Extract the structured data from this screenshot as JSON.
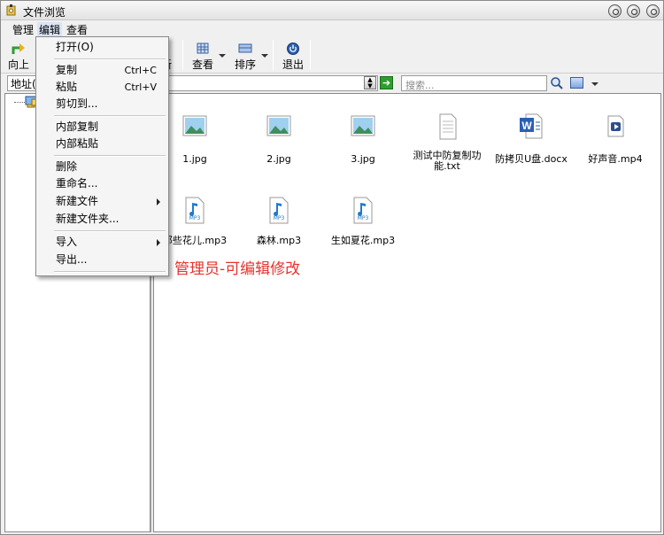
{
  "window": {
    "title": "文件浏览"
  },
  "menubar": {
    "items": [
      "管理",
      "编辑",
      "查看"
    ]
  },
  "toolbar": {
    "up_label": "向上",
    "refresh_label_partial": "新",
    "view_label": "查看",
    "sort_label": "排序",
    "exit_label": "退出"
  },
  "addressbar": {
    "label": "地址(",
    "search_placeholder": "搜索..."
  },
  "edit_menu": {
    "open": "打开(O)",
    "copy": "复制",
    "copy_shortcut": "Ctrl+C",
    "paste": "粘贴",
    "paste_shortcut": "Ctrl+V",
    "cut_to": "剪切到...",
    "internal_copy": "内部复制",
    "internal_paste": "内部粘贴",
    "delete": "删除",
    "rename": "重命名...",
    "new_file": "新建文件",
    "new_folder": "新建文件夹...",
    "import": "导入",
    "export": "导出..."
  },
  "files": [
    {
      "name": "1.jpg",
      "icon": "image-icon"
    },
    {
      "name": "2.jpg",
      "icon": "image-icon"
    },
    {
      "name": "3.jpg",
      "icon": "image-icon"
    },
    {
      "name": "测试中防复制功能.txt",
      "icon": "text-file-icon"
    },
    {
      "name": "防拷贝U盘.docx",
      "icon": "word-icon"
    },
    {
      "name": "好声音.mp4",
      "icon": "video-icon"
    },
    {
      "name": "那些花儿.mp3",
      "icon": "mp3-icon"
    },
    {
      "name": "森林.mp3",
      "icon": "mp3-icon"
    },
    {
      "name": "生如夏花.mp3",
      "icon": "mp3-icon"
    }
  ],
  "overlay": {
    "text": "管理员-可编辑修改"
  },
  "colors": {
    "overlay_text": "#e8322d",
    "menu_highlight": "#d9e4f5"
  }
}
